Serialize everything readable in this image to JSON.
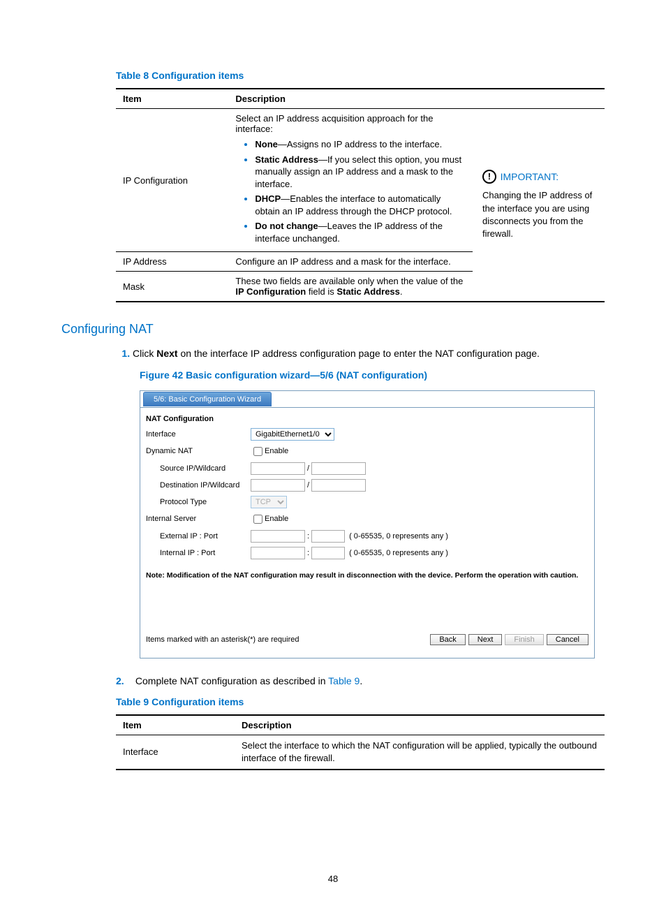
{
  "table8": {
    "caption": "Table 8 Configuration items",
    "headers": {
      "item": "Item",
      "desc": "Description"
    },
    "rows": {
      "ipconfig": {
        "item": "IP Configuration",
        "intro": "Select an IP address acquisition approach for the interface:",
        "bullets": {
          "none": {
            "bold": "None",
            "rest": "—Assigns no IP address to the interface."
          },
          "static": {
            "bold": "Static Address",
            "rest": "—If you select this option, you must manually assign an IP address and a mask to the interface."
          },
          "dhcp": {
            "bold": "DHCP",
            "rest": "—Enables the interface to automatically obtain an IP address through the DHCP protocol."
          },
          "nochange": {
            "bold": "Do not change",
            "rest": "—Leaves the IP address of the interface unchanged."
          }
        }
      },
      "ipaddr": {
        "item": "IP Address",
        "desc": "Configure an IP address and a mask for the interface."
      },
      "mask": {
        "item": "Mask",
        "desc_pre": "These two fields are available only when the value of the ",
        "desc_bold1": "IP Configuration",
        "desc_mid": " field is ",
        "desc_bold2": "Static Address",
        "desc_post": "."
      }
    },
    "important": {
      "title": "IMPORTANT:",
      "text": "Changing the IP address of the interface you are using disconnects you from the firewall."
    }
  },
  "section": {
    "heading": "Configuring NAT",
    "step1_pre": "Click ",
    "step1_bold": "Next",
    "step1_post": " on the interface IP address configuration page to enter the NAT configuration page.",
    "figure_caption": "Figure 42 Basic configuration wizard—5/6 (NAT configuration)",
    "step2_pre": "Complete NAT configuration as described in ",
    "step2_link": "Table 9",
    "step2_post": "."
  },
  "wizard": {
    "tab": "5/6: Basic Configuration Wizard",
    "section_title": "NAT Configuration",
    "labels": {
      "interface": "Interface",
      "dynamic_nat": "Dynamic NAT",
      "source": "Source IP/Wildcard",
      "destination": "Destination IP/Wildcard",
      "protocol": "Protocol Type",
      "internal_server": "Internal Server",
      "external_ip_port": "External IP : Port",
      "internal_ip_port": "Internal IP : Port"
    },
    "values": {
      "interface_value": "GigabitEthernet1/0",
      "enable1": "Enable",
      "enable2": "Enable",
      "protocol_value": "TCP",
      "slash": "/",
      "colon": ":",
      "port_hint": "( 0-65535, 0 represents any )"
    },
    "note": "Note: Modification of the NAT configuration may result in disconnection with the device. Perform the operation with caution.",
    "required_text": "Items marked with an asterisk(*) are required",
    "buttons": {
      "back": "Back",
      "next": "Next",
      "finish": "Finish",
      "cancel": "Cancel"
    }
  },
  "table9": {
    "caption": "Table 9 Configuration items",
    "headers": {
      "item": "Item",
      "desc": "Description"
    },
    "row": {
      "item": "Interface",
      "desc": "Select the interface to which the NAT configuration will be applied, typically the outbound interface of the firewall."
    }
  },
  "page_number": "48"
}
